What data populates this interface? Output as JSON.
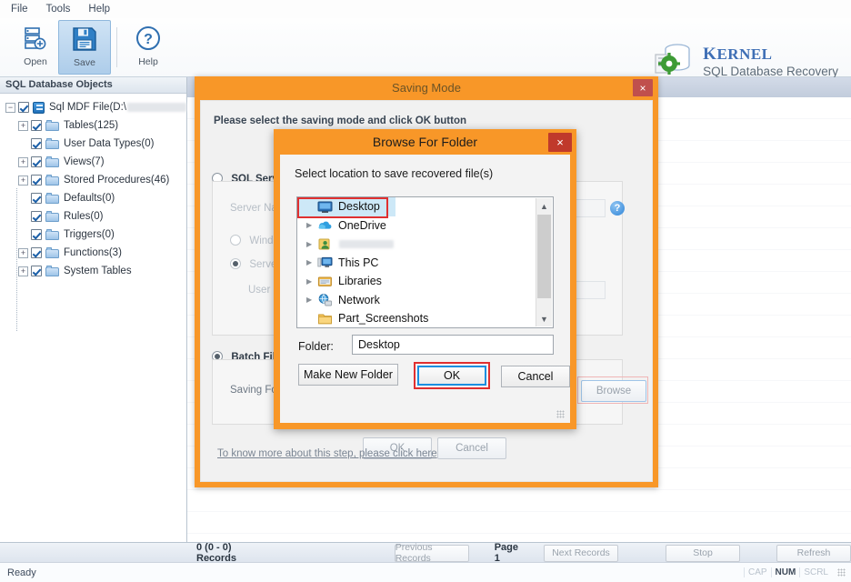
{
  "menubar": {
    "items": [
      "File",
      "Tools",
      "Help"
    ]
  },
  "toolbar": {
    "buttons": [
      {
        "label": "Open",
        "icon": "open-database-icon"
      },
      {
        "label": "Save",
        "icon": "save-floppy-icon"
      },
      {
        "label": "Help",
        "icon": "help-question-icon"
      }
    ]
  },
  "brand": {
    "name": "Kernel",
    "name_cap": "K",
    "name_rest": "ERNEL",
    "product": "SQL Database Recovery"
  },
  "sidebar": {
    "header": "SQL Database Objects",
    "root": {
      "label": "Sql MDF File(D:\\",
      "redacted": true
    },
    "items": [
      {
        "label": "Tables(125)",
        "expandable": true
      },
      {
        "label": "User Data Types(0)",
        "expandable": false
      },
      {
        "label": "Views(7)",
        "expandable": true
      },
      {
        "label": "Stored Procedures(46)",
        "expandable": true
      },
      {
        "label": "Defaults(0)",
        "expandable": false
      },
      {
        "label": "Rules(0)",
        "expandable": false
      },
      {
        "label": "Triggers(0)",
        "expandable": false
      },
      {
        "label": "Functions(3)",
        "expandable": true
      },
      {
        "label": "System Tables",
        "expandable": true
      }
    ]
  },
  "recordbar": {
    "records": "0 (0 - 0) Records",
    "previous": "Previous Records",
    "page": "Page 1",
    "next": "Next Records",
    "stop": "Stop",
    "refresh": "Refresh"
  },
  "statusbar": {
    "ready": "Ready",
    "indicators": [
      {
        "label": "CAP",
        "active": false
      },
      {
        "label": "NUM",
        "active": true
      },
      {
        "label": "SCRL",
        "active": false
      }
    ]
  },
  "saving_mode": {
    "title": "Saving Mode",
    "close": "×",
    "prompt": "Please select the saving mode and click OK button",
    "sql_server": {
      "label": "SQL Server",
      "selected": false,
      "server_name_label": "Server Name",
      "server_name_value": "",
      "windows_auth_label": "Windows Authentication",
      "windows_auth_selected": false,
      "server_auth_label": "Server Authentication",
      "server_auth_selected": true,
      "user_name_label": "User Name",
      "user_name_value": ""
    },
    "batch_file": {
      "label": "Batch File",
      "selected": true,
      "saving_folder_label": "Saving Folder",
      "saving_folder_value": "",
      "browse": "Browse"
    },
    "ok": "OK",
    "cancel": "Cancel",
    "help_icon": "help-question-icon",
    "more_link": "To know more about this step, please click here"
  },
  "browse_dialog": {
    "title": "Browse For Folder",
    "close": "×",
    "prompt": "Select location to save recovered file(s)",
    "tree": [
      {
        "label": "Desktop",
        "icon": "desktop-monitor-icon",
        "expandable": false,
        "selected": true,
        "redacted": false,
        "indent": 0
      },
      {
        "label": "OneDrive",
        "icon": "onedrive-cloud-icon",
        "expandable": true,
        "selected": false,
        "redacted": false,
        "indent": 0
      },
      {
        "label": "",
        "icon": "user-account-icon",
        "expandable": true,
        "selected": false,
        "redacted": true,
        "indent": 0
      },
      {
        "label": "This PC",
        "icon": "this-pc-icon",
        "expandable": true,
        "selected": false,
        "redacted": false,
        "indent": 0
      },
      {
        "label": "Libraries",
        "icon": "libraries-icon",
        "expandable": true,
        "selected": false,
        "redacted": false,
        "indent": 0
      },
      {
        "label": "Network",
        "icon": "network-globe-icon",
        "expandable": true,
        "selected": false,
        "redacted": false,
        "indent": 0
      },
      {
        "label": "Part_Screenshots",
        "icon": "folder-icon",
        "expandable": false,
        "selected": false,
        "redacted": false,
        "indent": 0
      }
    ],
    "folder_label": "Folder:",
    "folder_value": "Desktop",
    "make_new_folder": "Make New Folder",
    "ok": "OK",
    "cancel": "Cancel"
  },
  "colors": {
    "accent_orange": "#f89728",
    "close_red": "#c0392b",
    "highlight_red": "#e03030",
    "selection_blue": "#cde8f7",
    "focus_blue": "#1a8fe0",
    "brand_blue": "#3f6fb5"
  }
}
